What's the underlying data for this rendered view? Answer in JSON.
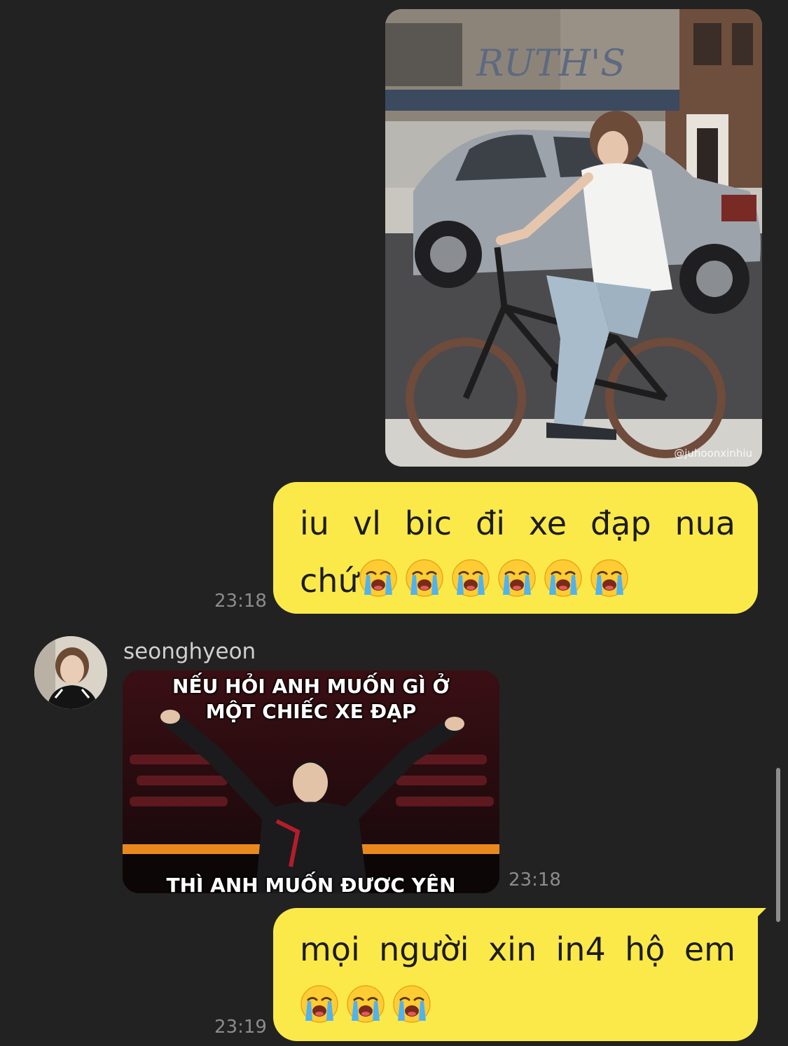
{
  "messages": [
    {
      "photo_watermark": "@juhoonxinhiu"
    },
    {
      "line1_words": [
        "iu",
        "vl",
        "bic",
        "đi",
        "xe",
        "đạp",
        "nua"
      ],
      "line2_text": "chứ",
      "emoji_count": 6,
      "emoji_name": "loudly-crying-face",
      "time": "23:18"
    },
    {
      "sender": "seonghyeon",
      "caption_top_1": "NẾU HỎI ANH MUỐN GÌ Ở",
      "caption_top_2": "MỘT CHIẾC XE ĐẠP",
      "caption_bottom": "THÌ ANH MUỐN ĐƯỢC YÊN",
      "time": "23:18"
    },
    {
      "line1_words": [
        "mọi",
        "người",
        "xin",
        "in4",
        "hộ",
        "em"
      ],
      "emoji_count": 3,
      "emoji_name": "loudly-crying-face",
      "time": "23:19"
    }
  ],
  "colors": {
    "background": "#222222",
    "bubble": "#fbe94a",
    "timestamp": "#8c8c8c"
  }
}
